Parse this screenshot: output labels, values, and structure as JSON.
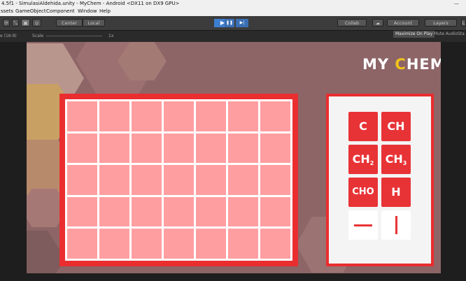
{
  "window": {
    "title": "4.5f1 - SimulasiAldehida.unity - MyChem - Android <DX11 on DX9 GPU>",
    "minimize_glyph": "—"
  },
  "menu": [
    "ssets",
    "GameObject",
    "Component",
    "Window",
    "Help"
  ],
  "toolbar": {
    "pivot_label": "Center",
    "space_label": "Local",
    "collab_label": "Collab",
    "account_label": "Account",
    "layers_label": "Layers",
    "layout_label": "L",
    "play_glyph": "▶",
    "pause_glyph": "❚❚",
    "step_glyph": "▶|"
  },
  "gamebar": {
    "aspect_label": "e (16:9)",
    "scale_label": "Scale",
    "scale_value": "1x",
    "maximize_label": "Maximize On Play",
    "mute_label": "Mute Audio",
    "stats_label": "Sta"
  },
  "game": {
    "logo_left": "MY",
    "logo_c": "C",
    "logo_right": "HEM",
    "grid_rows": 5,
    "grid_cols": 7,
    "chips": [
      "C",
      "CH",
      "CH2",
      "CH3",
      "CHO",
      "H"
    ],
    "bonds": [
      "single-bond-horizontal",
      "single-bond-vertical"
    ]
  },
  "colors": {
    "background": "#8d6567",
    "board_frame": "#ea2d2f",
    "cell": "#ff9ea0",
    "chip": "#e83336",
    "logo_accent": "#f0c419"
  }
}
